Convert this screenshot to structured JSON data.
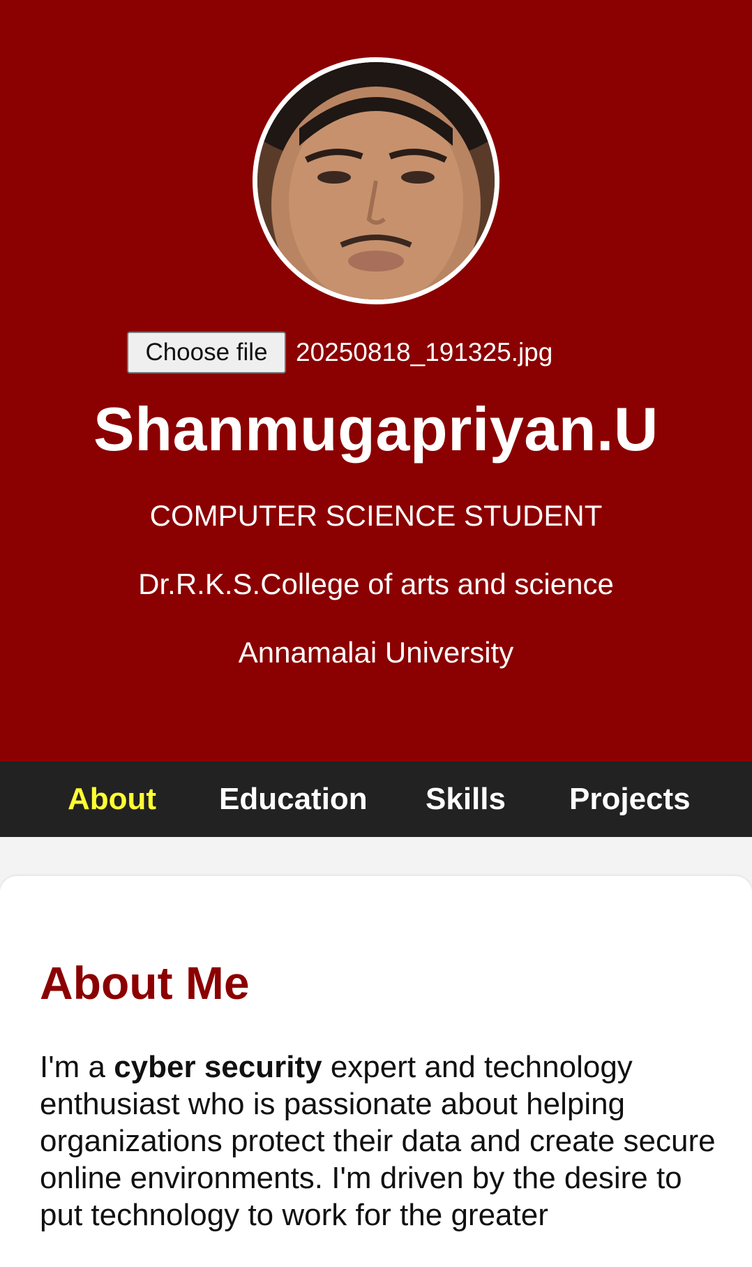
{
  "header": {
    "background_color": "#8b0000",
    "avatar_alt": "profile photo",
    "file_input": {
      "button_label": "Choose file",
      "file_name": "20250818_191325.jpg"
    },
    "name": "Shanmugapriyan.U",
    "role": "COMPUTER SCIENCE STUDENT",
    "college": "Dr.R.K.S.College of arts and science",
    "university": "Annamalai University"
  },
  "nav": {
    "background_color": "#222222",
    "active_color": "#ffff33",
    "items": [
      {
        "label": "About",
        "active": true
      },
      {
        "label": "Education",
        "active": false
      },
      {
        "label": "Skills",
        "active": false
      },
      {
        "label": "Projects",
        "active": false
      }
    ]
  },
  "about": {
    "title": "About Me",
    "text_before": "I'm a ",
    "text_bold": "cyber security",
    "text_after": " expert and technology enthusiast who is passionate about helping organizations protect their data and create secure online environments. I'm driven by the desire to put technology to work for the greater"
  }
}
